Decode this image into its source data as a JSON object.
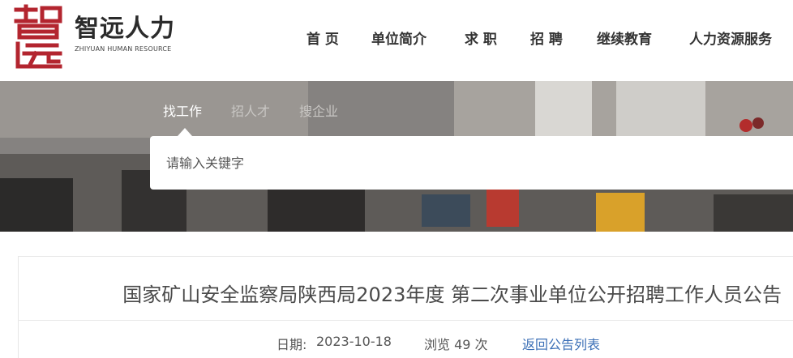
{
  "brand": {
    "logo_mark_text": "智远",
    "name": "智远人力",
    "subtitle": "ZHIYUAN HUMAN RESOURCE",
    "logo_color": "#b3252f"
  },
  "nav": {
    "items": [
      {
        "label": "首 页"
      },
      {
        "label": "单位简介"
      },
      {
        "label": "求 职"
      },
      {
        "label": "招 聘"
      },
      {
        "label": "继续教育"
      },
      {
        "label": "人力资源服务"
      }
    ]
  },
  "search": {
    "tabs": [
      {
        "label": "找工作",
        "active": true
      },
      {
        "label": "招人才",
        "active": false
      },
      {
        "label": "搜企业",
        "active": false
      }
    ],
    "placeholder": "请输入关键字"
  },
  "article": {
    "title": "国家矿山安全监察局陕西局2023年度 第二次事业单位公开招聘工作人员公告",
    "date_label": "日期:",
    "date_value": "2023-10-18",
    "views_text": "浏览 49 次",
    "back_link": "返回公告列表"
  }
}
